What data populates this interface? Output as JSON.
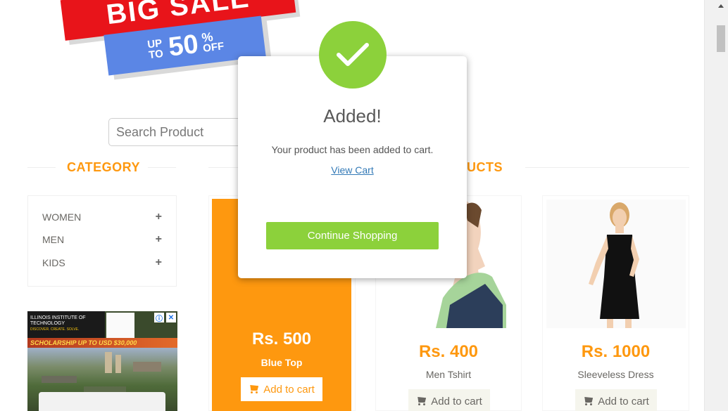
{
  "banner": {
    "line1": "BIG SALE",
    "upto": "UP TO",
    "percent": "50",
    "pct_sign": "%",
    "off": "OFF"
  },
  "search": {
    "placeholder": "Search Product"
  },
  "category": {
    "title": "CATEGORY",
    "items": [
      {
        "label": "WOMEN",
        "icon": "plus-icon"
      },
      {
        "label": "MEN",
        "icon": "plus-icon"
      },
      {
        "label": "KIDS",
        "icon": "plus-icon"
      }
    ]
  },
  "products_section": {
    "title_visible": "UCTS"
  },
  "ad": {
    "institute": "ILLINOIS INSTITUTE OF TECHNOLOGY",
    "tagline": "DISCOVER. CREATE. SOLVE.",
    "banner": "SCHOLARSHIP UP TO USD $30,000",
    "info_icon": "ⓘ",
    "close_icon": "✕"
  },
  "products": [
    {
      "price": "Rs. 500",
      "name": "Blue Top",
      "cta": "Add to cart"
    },
    {
      "price": "Rs. 400",
      "name": "Men Tshirt",
      "cta": "Add to cart"
    },
    {
      "price": "Rs. 1000",
      "name": "Sleeveless Dress",
      "cta": "Add to cart"
    }
  ],
  "modal": {
    "title": "Added!",
    "message": "Your product has been added to cart.",
    "link": "View Cart",
    "button": "Continue Shopping",
    "accent": "#8cd13b"
  },
  "colors": {
    "brand_orange": "#fe980f",
    "success_green": "#8cd13b"
  }
}
